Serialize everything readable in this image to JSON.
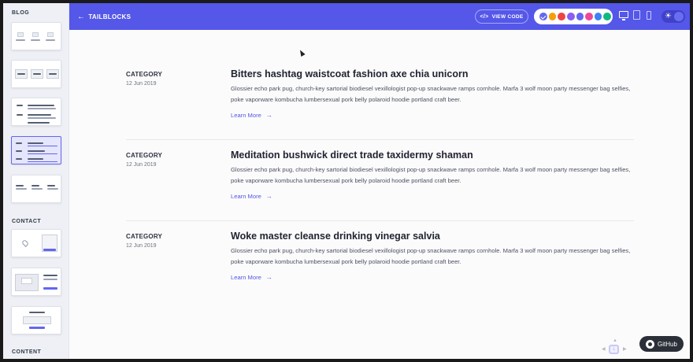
{
  "sidebar": {
    "sections": [
      "BLOG",
      "CONTACT",
      "CONTENT"
    ]
  },
  "topbar": {
    "back_label": "TAILBLOCKS",
    "view_code_label": "VIEW CODE",
    "colors": [
      "#6366f1",
      "#f59e0b",
      "#ef4444",
      "#8b5cf6",
      "#6366f1",
      "#ec4899",
      "#3b82f6",
      "#10b981"
    ],
    "selected_color_index": 0,
    "theme_icon": "sun-icon"
  },
  "posts": [
    {
      "category": "CATEGORY",
      "date": "12 Jun 2019",
      "title": "Bitters hashtag waistcoat fashion axe chia unicorn",
      "description": "Glossier echo park pug, church-key sartorial biodiesel vexillologist pop-up snackwave ramps cornhole. Marfa 3 wolf moon party messenger bag selfies, poke vaporware kombucha lumbersexual pork belly polaroid hoodie portland craft beer.",
      "link": "Learn More"
    },
    {
      "category": "CATEGORY",
      "date": "12 Jun 2019",
      "title": "Meditation bushwick direct trade taxidermy shaman",
      "description": "Glossier echo park pug, church-key sartorial biodiesel vexillologist pop-up snackwave ramps cornhole. Marfa 3 wolf moon party messenger bag selfies, poke vaporware kombucha lumbersexual pork belly polaroid hoodie portland craft beer.",
      "link": "Learn More"
    },
    {
      "category": "CATEGORY",
      "date": "12 Jun 2019",
      "title": "Woke master cleanse drinking vinegar salvia",
      "description": "Glossier echo park pug, church-key sartorial biodiesel vexillologist pop-up snackwave ramps cornhole. Marfa 3 wolf moon party messenger bag selfies, poke vaporware kombucha lumbersexual pork belly polaroid hoodie portland craft beer.",
      "link": "Learn More"
    }
  ],
  "github_label": "GitHub"
}
